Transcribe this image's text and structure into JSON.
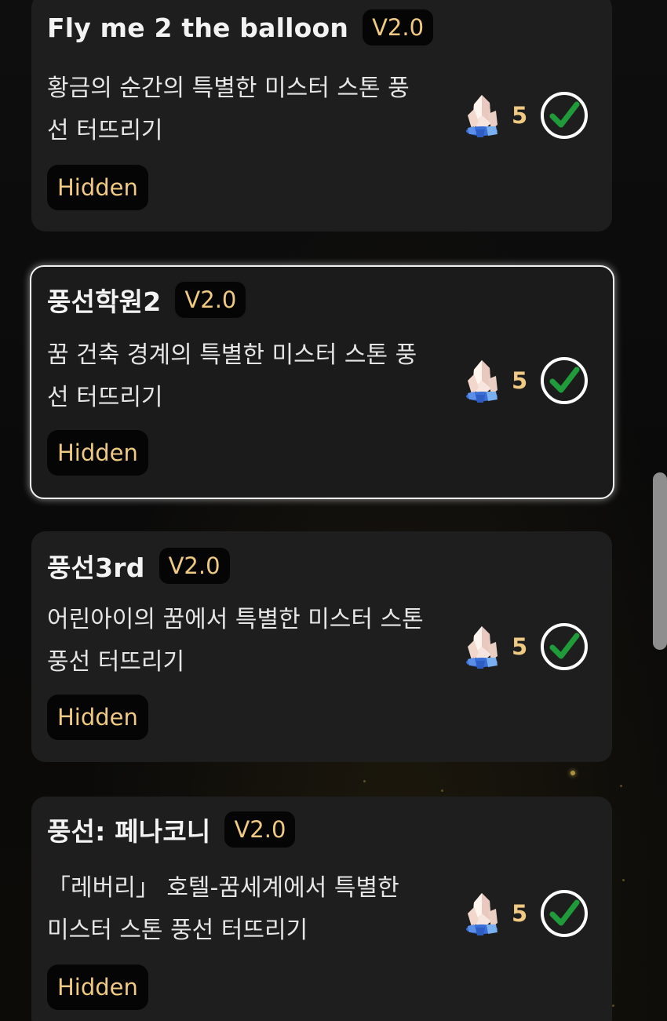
{
  "achievements": [
    {
      "title": "Fly me 2 the balloon",
      "version": "V2.0",
      "description": "황금의 순간의 특별한 미스터 스톤 풍선 터뜨리기",
      "tag": "Hidden",
      "reward_count": "5",
      "completed": true
    },
    {
      "title": "풍선학원2",
      "version": "V2.0",
      "description": "꿈 건축 경계의 특별한 미스터 스톤 풍선 터뜨리기",
      "tag": "Hidden",
      "reward_count": "5",
      "completed": true
    },
    {
      "title": "풍선3rd",
      "version": "V2.0",
      "description": "어린아이의 꿈에서 특별한 미스터 스톤 풍선 터뜨리기",
      "tag": "Hidden",
      "reward_count": "5",
      "completed": true
    },
    {
      "title": "풍선: 페나코니",
      "version": "V2.0",
      "description": "「레버리」 호텔-꿈세계에서 특별한 미스터 스톤 풍선 터뜨리기",
      "tag": "Hidden",
      "reward_count": "5",
      "completed": true
    }
  ],
  "colors": {
    "card_bg": "#1e1e1e",
    "accent_gold": "#f0c983",
    "check_green": "#1f9b3a"
  },
  "icons": {
    "reward": "crystal-icon",
    "status": "check-circle-icon"
  }
}
